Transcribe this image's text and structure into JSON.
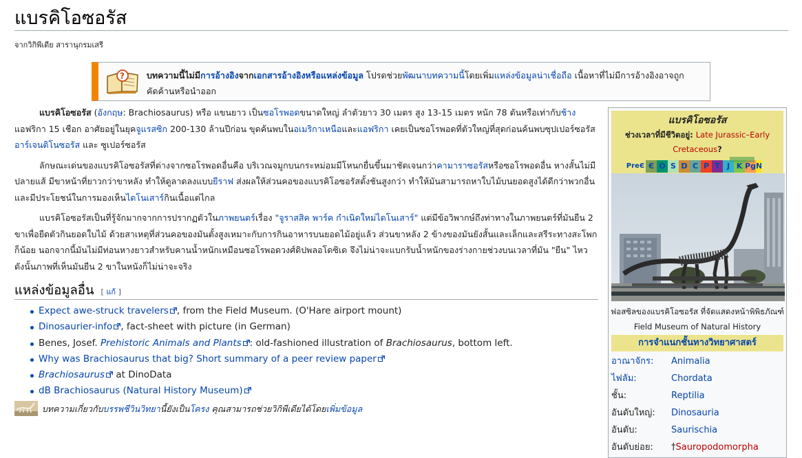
{
  "title": "แบรคิโอซอรัส",
  "subtitle": "จากวิกิพีเดีย สารานุกรมเสรี",
  "notice": {
    "icon": "book-question-icon",
    "part1": "บทความนี้ไม่มี",
    "link1": "การอ้างอิง",
    "part2": "จาก",
    "link2": "เอกสารอ้างอิงหรือแหล่งข้อมูล",
    "part3": " โปรดช่วย",
    "link3": "พัฒนาบทความนี้",
    "part4": "โดยเพิ่ม",
    "link4": "แหล่งข้อมูลน่าเชื่อถือ",
    "part5": " เนื้อหาที่ไม่มีการอ้างอิงอาจถูกคัดค้านหรือนำออก"
  },
  "para1": {
    "bold": "แบรคิโอซอรัส",
    "t1": " (",
    "l1": "อังกฤษ",
    "t2": ": Brachiosaurus) หรือ แขนยาว เป็น",
    "l2": "ซอโรพอด",
    "t3": "ขนาดใหญ่ ลำตัวยาว 30 เมตร สูง 13-15 เมตร หนัก 78 ตันหรือเท่ากับ",
    "l3": "ช้าง",
    "t4": "แอฟริกา 15 เชือก อาศัยอยู่ในยุค",
    "l4": "จูแรสซิก",
    "t5": " 200-130 ล้านปีก่อน ขุดค้นพบใน",
    "l5": "อเมริกาเหนือ",
    "t6": "และ",
    "l6": "แอฟริกา",
    "t7": " เคยเป็นซอโรพอดที่ตัวใหญ่ที่สุดก่อนค้นพบซุปเปอร์ซอรัส ",
    "l7": "อาร์เจนติโนซอรัส",
    "t8": " และ ซูเปอร์ซอรัส"
  },
  "para2": {
    "t1": "ลักษณะเด่นของแบรคิโอซอรัสที่ต่างจากซอโรพอดอื่นคือ บริเวณจมูกบนกระหม่อมมีโหนกยื่นขึ้นมาชัดเจนกว่า",
    "l1": "คามาราซอรัส",
    "t2": "หรือซอโรพอดอื่น หางสั้นไม่มีปลายแส้ มีขาหน้าที่ยาวกว่าขาหลัง ทำให้ดูลาดลงแบบ",
    "l2": "ยีราฟ",
    "t3": " ส่งผลให้ส่วนคอของแบรคิโอซอรัสตั้งชันสูงกว่า ทำให้มันสามารถหาใบไม้บนยอดสูงได้ดีกว่าพวกอื่น และมีประโยชน์ในการมองเห็น",
    "l3": "ไดโนเสาร์",
    "t4": "กินเนื้อแต่ไกล"
  },
  "para3": {
    "t1": "แบรคิโอซอรัสเป็นที่รู้จักมากจากการปรากฏตัวใน",
    "l1": "ภาพยนตร์",
    "t2": "เรื่อง ",
    "l2": "\"จูราสสิค พาร์ค กำเนิดใหม่ไดโนเสาร์\"",
    "t3": " แต่มีข้อวิพากษ์ถึงท่าทางในภาพยนตร์ที่มันยืน 2 ขาเพื่อยืดตัวกินยอดใบไม้ ด้วยสาเหตุที่ส่วนคอของมันตั้งสูงเหมาะกับการกินอาหารบนยอดไม้อยู่แล้ว ส่วนขาหลัง 2 ข้างของมันยังสั้นและเล็กและสรีระทางสะโพกก็น้อย นอกจากนี้มันไม่มีท่อนหางยาวสำหรับคานน้ำหนักเหมือนซอโรพอดวงศ์ดิปพลอโดซิเด จึงไม่น่าจะแบกรับน้ำหนักของร่างกายช่วงบนเวลาที่มัน \"ยืน\" ไหว ดังนั้นภาพที่เห็นมันยืน 2 ขาในหนังก็ไม่น่าจะจริง"
  },
  "section": {
    "heading": "แหล่งข้อมูลอื่น",
    "edit_open": "[ ",
    "edit_label": "แก้",
    "edit_close": " ]"
  },
  "refs": [
    {
      "link": "Expect awe-struck travelers",
      "ext": true,
      "rest": ", from the Field Museum. (O'Hare airport mount)"
    },
    {
      "link": "Dinosaurier-info",
      "ext": true,
      "rest": ", fact-sheet with picture (in German)"
    },
    {
      "pre": "Benes, Josef. ",
      "link": "Prehistoric Animals and Plants",
      "ext": true,
      "rest": ": old-fashioned illustration of ",
      "rest_italic": "Brachiosaurus",
      "rest2": ", bottom left."
    },
    {
      "link": "Why was Brachiosaurus that big? Short summary of a peer review paper",
      "ext": true
    },
    {
      "link": "Brachiosaurus",
      "ext": true,
      "rest": " at DinoData"
    },
    {
      "link": "dB Brachiosaurus (Natural History Museum)",
      "ext": true
    }
  ],
  "stub": {
    "t1": "บทความเกี่ยวกับ",
    "l1": "บรรพชีวินวิทยา",
    "t2": "นี้ยังเป็น",
    "l2": "โครง",
    "t3": " คุณสามารถช่วยวิกิพีเดียได้โดย",
    "l3": "เพิ่มข้อมูล"
  },
  "infobox": {
    "title": "แบรคิโอซอรัส",
    "range_label": "ช่วงเวลาที่มีชีวิตอยู่: ",
    "range_value": "Late Jurassic–Early Cretaceous",
    "range_q": "?",
    "timescale": [
      "PreЄ",
      "Є",
      "O",
      "S",
      "D",
      "C",
      "P",
      "T",
      "J",
      "K",
      "Pg",
      "N"
    ],
    "timescale_colors": [
      "#f74370",
      "#7fa056",
      "#009270",
      "#b3e1b6",
      "#cb8c37",
      "#67a599",
      "#f04028",
      "#812b92",
      "#34b2c9",
      "#7fc64e",
      "#fd9a52",
      "#ffe619"
    ],
    "caption": "ฟอสซิลของแบรคิโอซอรัส ที่จัดแสดงหน้าพิพิธภัณฑ์ Field Museum of Natural History",
    "section": "การจำแนกชั้นทางวิทยาศาสตร์",
    "rows": [
      {
        "key": "อาณาจักร:",
        "value": "Animalia",
        "key_link": true
      },
      {
        "key": "ไฟลัม:",
        "value": "Chordata",
        "key_link": true
      },
      {
        "key": "ชั้น:",
        "value": "Reptilia"
      },
      {
        "key": "อันดับใหญ่:",
        "value": "Dinosauria"
      },
      {
        "key": "อันดับ:",
        "value": "Saurischia"
      },
      {
        "key": "อันดับย่อย:",
        "value": "Sauropodomorpha",
        "dagger": "†",
        "red": true
      }
    ]
  }
}
